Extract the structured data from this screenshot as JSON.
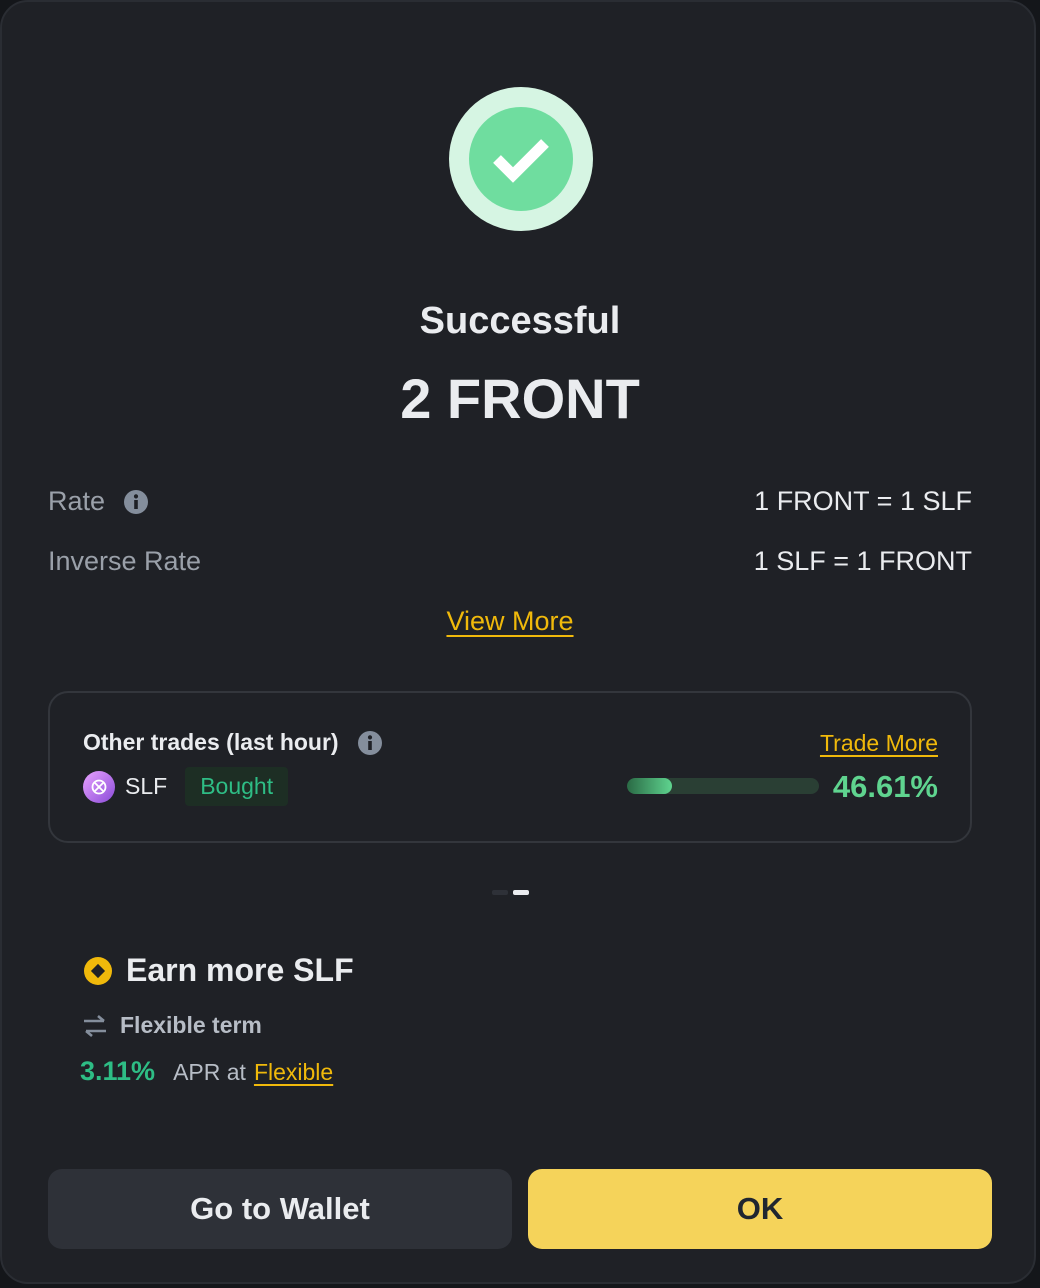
{
  "header": {
    "title": "Successful",
    "amount": "2 FRONT"
  },
  "rates": [
    {
      "label": "Rate",
      "value": "1 FRONT = 1 SLF",
      "has_info": true
    },
    {
      "label": "Inverse Rate",
      "value": "1 SLF = 1 FRONT",
      "has_info": false
    }
  ],
  "view_more_label": "View More",
  "trades": {
    "title": "Other trades (last hour)",
    "trade_more_label": "Trade More",
    "coin": "SLF",
    "badge": "Bought",
    "percent_text": "46.61%",
    "percent_value": 0.4661
  },
  "carousel": {
    "count": 2,
    "active": 1
  },
  "earn": {
    "title": "Earn more SLF",
    "term": "Flexible term",
    "apr": "3.11%",
    "apr_text": "APR at",
    "apr_link": "Flexible"
  },
  "buttons": {
    "wallet": "Go to Wallet",
    "ok": "OK"
  },
  "colors": {
    "accent": "#f0b90b",
    "success": "#2ebd85",
    "ok_button": "#f5d35a"
  }
}
